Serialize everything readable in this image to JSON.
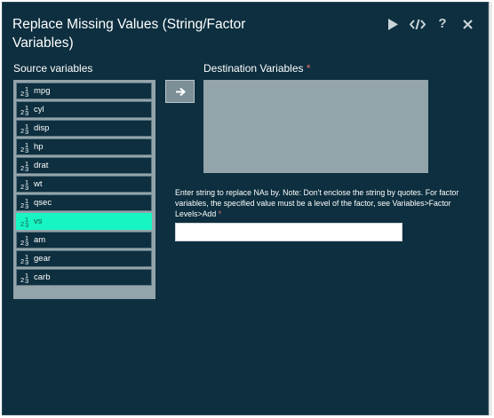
{
  "dialog": {
    "title": "Replace Missing Values (String/Factor Variables)"
  },
  "source": {
    "label": "Source variables",
    "variables": [
      {
        "name": "mpg",
        "selected": false
      },
      {
        "name": "cyl",
        "selected": false
      },
      {
        "name": "disp",
        "selected": false
      },
      {
        "name": "hp",
        "selected": false
      },
      {
        "name": "drat",
        "selected": false
      },
      {
        "name": "wt",
        "selected": false
      },
      {
        "name": "qsec",
        "selected": false
      },
      {
        "name": "vs",
        "selected": true
      },
      {
        "name": "am",
        "selected": false
      },
      {
        "name": "gear",
        "selected": false
      },
      {
        "name": "carb",
        "selected": false
      }
    ],
    "type_icon": "numeric-icon"
  },
  "destination": {
    "label": "Destination Variables",
    "required_mark": "*"
  },
  "na_string": {
    "instructions": "Enter string to replace NAs by. Note: Don't enclose the string by quotes. For factor variables, the specified value must be a level of the factor, see Variables>Factor Levels>Add",
    "required_mark": "*",
    "value": ""
  },
  "colors": {
    "panel_bg": "#0d2f3f",
    "list_bg": "#93a4aa",
    "selected_bg": "#16f5c3",
    "required": "#e86b6b"
  }
}
